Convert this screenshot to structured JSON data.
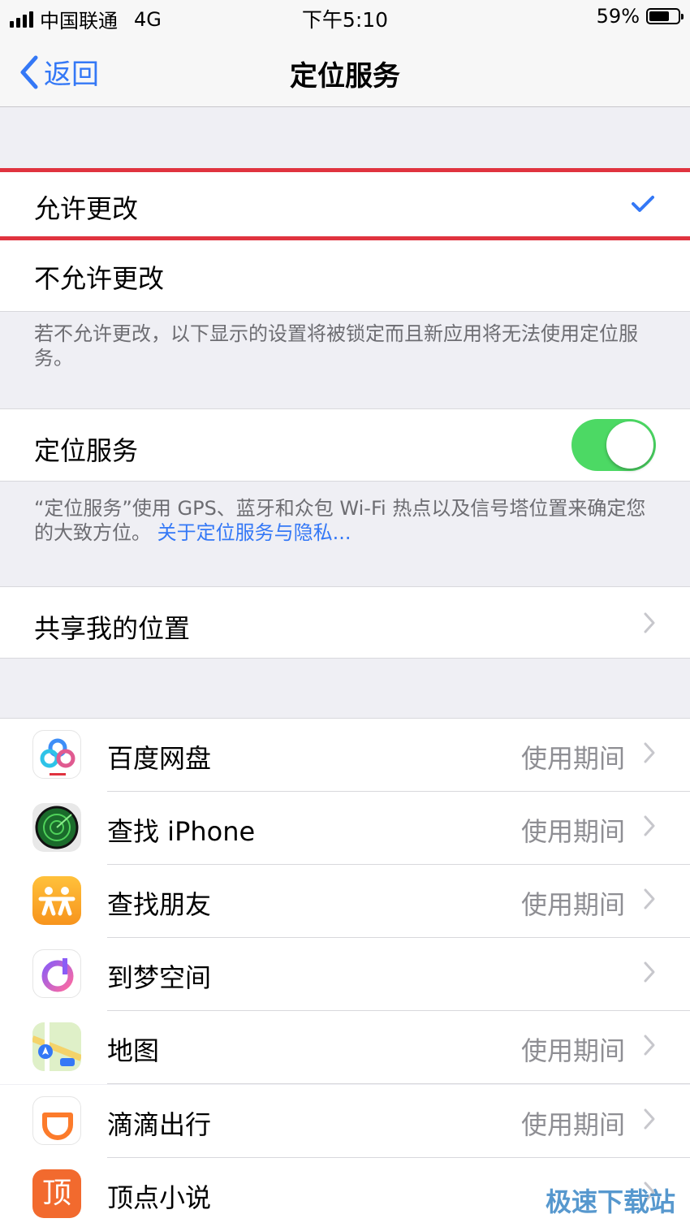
{
  "status_bar": {
    "carrier": "中国联通",
    "network": "4G",
    "time": "下午5:10",
    "battery_percent": "59%",
    "battery_level": 0.59
  },
  "nav": {
    "back_label": "返回",
    "title": "定位服务"
  },
  "options": {
    "allow": "允许更改",
    "disallow": "不允许更改",
    "footer": "若不允许更改，以下显示的设置将被锁定而且新应用将无法使用定位服务。"
  },
  "location_services": {
    "label": "定位服务",
    "enabled": true,
    "footer_text": "“定位服务”使用 GPS、蓝牙和众包 Wi-Fi 热点以及信号塔位置来确定您的大致方位。",
    "footer_link": "关于定位服务与隐私..."
  },
  "share": {
    "label": "共享我的位置"
  },
  "apps": [
    {
      "name": "百度网盘",
      "status": "使用期间",
      "icon": "baidu-netdisk-icon"
    },
    {
      "name": "查找 iPhone",
      "status": "使用期间",
      "icon": "find-iphone-icon"
    },
    {
      "name": "查找朋友",
      "status": "使用期间",
      "icon": "find-friends-icon"
    },
    {
      "name": "到梦空间",
      "status": "",
      "icon": "daomeng-icon"
    },
    {
      "name": "地图",
      "status": "使用期间",
      "icon": "maps-icon"
    },
    {
      "name": "滴滴出行",
      "status": "使用期间",
      "icon": "didi-icon"
    },
    {
      "name": "顶点小说",
      "status": "",
      "icon": "dingdian-icon",
      "icon_text": "顶"
    }
  ],
  "watermark": "极速下载站",
  "colors": {
    "accent": "#3478f6",
    "toggle_on": "#4cd964",
    "highlight": "#e0333f"
  }
}
